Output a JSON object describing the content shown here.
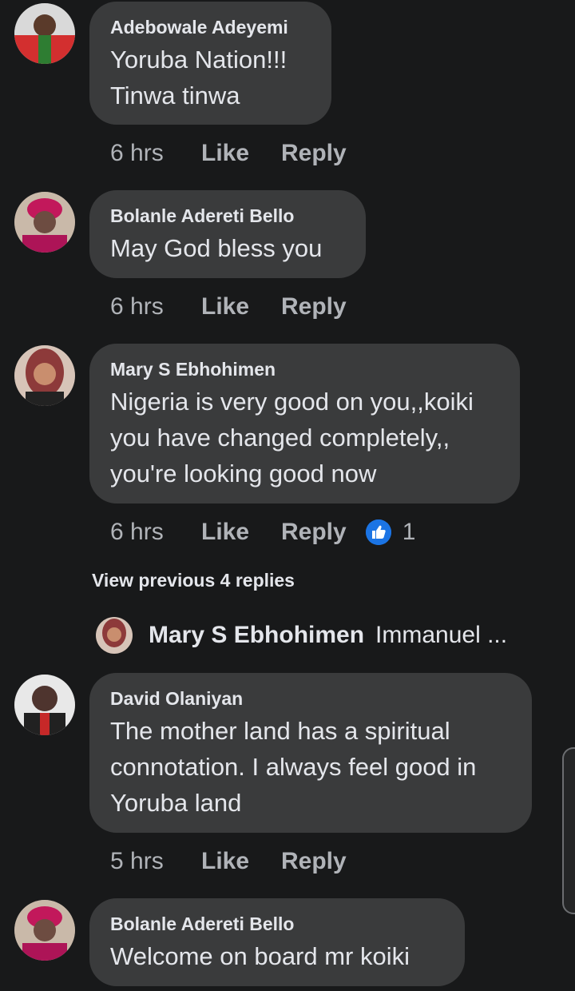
{
  "comments": [
    {
      "author": "Adebowale Adeyemi",
      "text_lines": [
        "Yoruba Nation!!!",
        "Tinwa tinwa"
      ],
      "time": "6 hrs",
      "like": "Like",
      "reply": "Reply"
    },
    {
      "author": "Bolanle Adereti Bello",
      "text_lines": [
        "May God bless you"
      ],
      "time": "6 hrs",
      "like": "Like",
      "reply": "Reply"
    },
    {
      "author": "Mary S Ebhohimen",
      "text_lines": [
        "Nigeria is very good on you,,koiki",
        "you have changed completely,,",
        "you're looking good now"
      ],
      "time": "6 hrs",
      "like": "Like",
      "reply": "Reply",
      "reaction_count": "1"
    },
    {
      "author": "David Olaniyan",
      "text_lines": [
        "The mother land has a spiritual",
        "connotation. I always feel good in",
        "Yoruba land"
      ],
      "time": "5 hrs",
      "like": "Like",
      "reply": "Reply"
    },
    {
      "author": "Bolanle Adereti Bello",
      "text_lines": [
        "Welcome on board mr koiki"
      ]
    }
  ],
  "view_previous": "View previous 4 replies",
  "reply_preview": {
    "author": "Mary S Ebhohimen",
    "text": "Immanuel ..."
  },
  "colors": {
    "background": "#18191a",
    "bubble": "#3a3b3c",
    "text": "#e4e6eb",
    "muted": "#b0b3b8",
    "like_blue": "#1b74e4"
  },
  "icons": {
    "reaction": "thumbs-up-icon"
  }
}
